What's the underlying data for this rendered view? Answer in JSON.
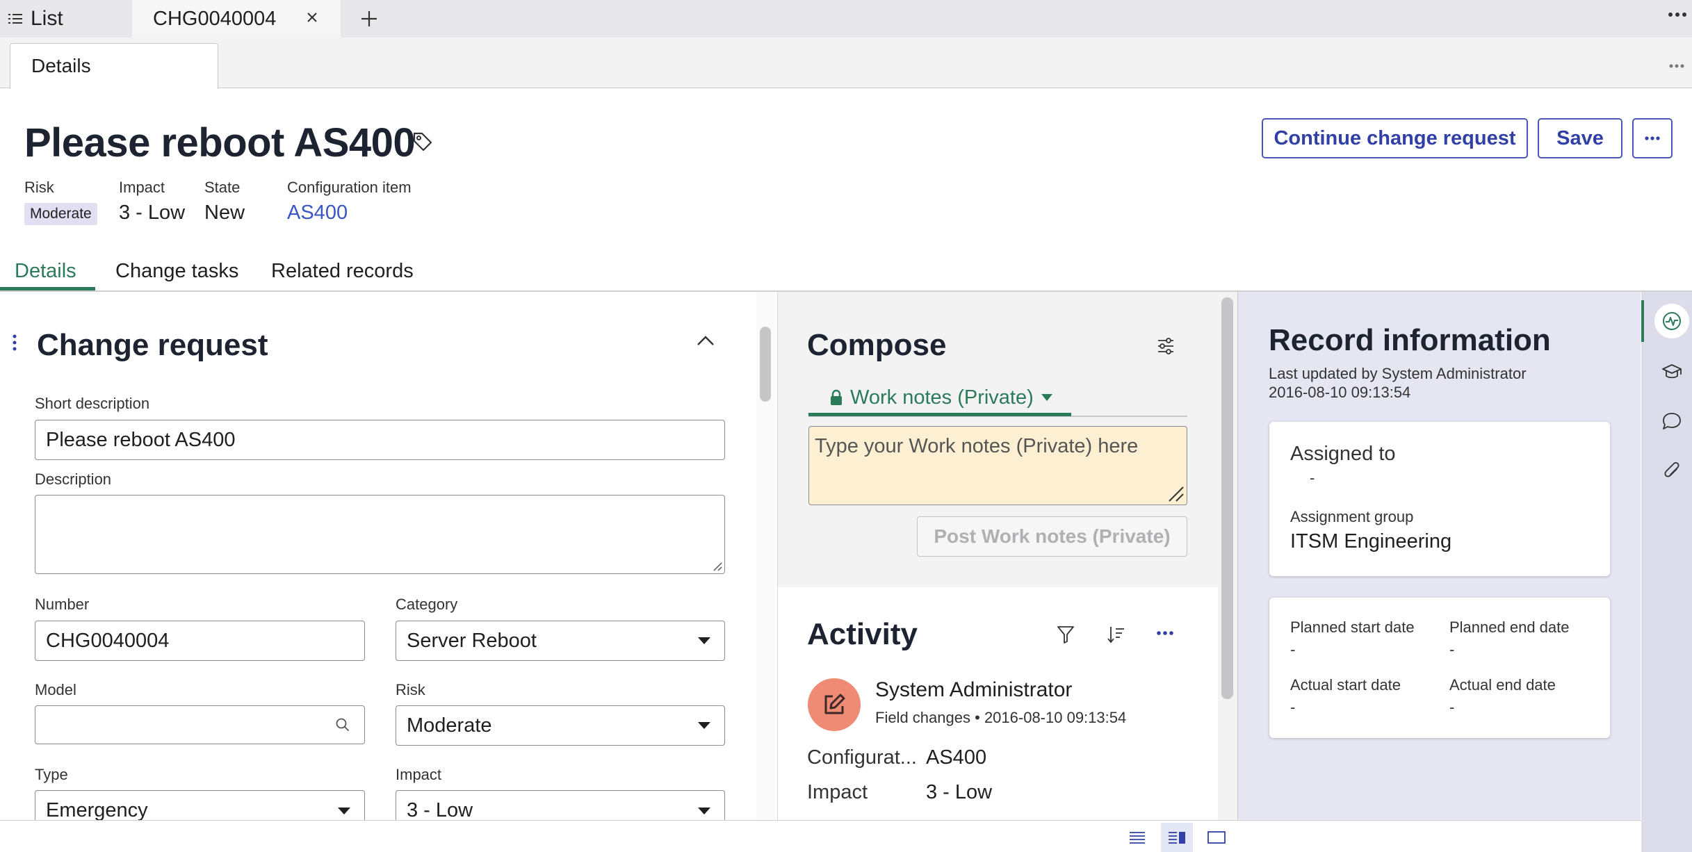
{
  "browser_tabs": {
    "list_label": "List",
    "active_tab_label": "CHG0040004"
  },
  "subtab": {
    "label": "Details"
  },
  "header": {
    "title": "Please reboot AS400",
    "buttons": {
      "continue": "Continue change request",
      "save": "Save",
      "more": "···"
    },
    "meta": {
      "risk_label": "Risk",
      "risk_value": "Moderate",
      "impact_label": "Impact",
      "impact_value": "3 - Low",
      "state_label": "State",
      "state_value": "New",
      "ci_label": "Configuration item",
      "ci_value": "AS400"
    }
  },
  "section_tabs": [
    "Details",
    "Change tasks",
    "Related records"
  ],
  "form": {
    "title": "Change request",
    "short_description_label": "Short description",
    "short_description_value": "Please reboot AS400",
    "description_label": "Description",
    "description_value": "",
    "number_label": "Number",
    "number_value": "CHG0040004",
    "category_label": "Category",
    "category_value": "Server Reboot",
    "model_label": "Model",
    "model_value": "",
    "risk_label": "Risk",
    "risk_value": "Moderate",
    "type_label": "Type",
    "type_value": "Emergency",
    "impact_label": "Impact",
    "impact_value": "3 - Low"
  },
  "compose": {
    "title": "Compose",
    "tab_label": "Work notes (Private)",
    "placeholder": "Type your Work notes (Private) here",
    "post_button": "Post Work notes (Private)"
  },
  "activity": {
    "title": "Activity",
    "entry": {
      "author": "System Administrator",
      "type": "Field changes",
      "timestamp": "2016-08-10 09:13:54",
      "fields": [
        {
          "key": "Configurat...",
          "value": "AS400"
        },
        {
          "key": "Impact",
          "value": "3 - Low"
        }
      ]
    }
  },
  "record_info": {
    "title": "Record information",
    "last_updated": "Last updated by System Administrator",
    "last_updated_time": "2016-08-10 09:13:54",
    "assigned_to_label": "Assigned to",
    "assigned_to_value": "-",
    "assignment_group_label": "Assignment group",
    "assignment_group_value": "ITSM Engineering",
    "planned_start_label": "Planned start date",
    "planned_start_value": "-",
    "planned_end_label": "Planned end date",
    "planned_end_value": "-",
    "actual_start_label": "Actual start date",
    "actual_start_value": "-",
    "actual_end_label": "Actual end date",
    "actual_end_value": "-"
  },
  "colors": {
    "accent_green": "#2b7a5a",
    "brand_blue": "#3140a6",
    "work_notes_bg": "#fdf0d2",
    "avatar": "#ef8a75"
  },
  "icons": [
    "list-icon",
    "close-icon",
    "plus-icon",
    "more-icon",
    "tag-icon",
    "drag-icon",
    "chevron-up-icon",
    "search-icon",
    "caret-down-icon",
    "settings-icon",
    "lock-icon",
    "filter-icon",
    "sort-icon",
    "edit-icon",
    "activity-icon",
    "graduation-icon",
    "chat-icon",
    "attachment-icon",
    "layout-compact-icon",
    "layout-split-icon",
    "layout-single-icon"
  ]
}
